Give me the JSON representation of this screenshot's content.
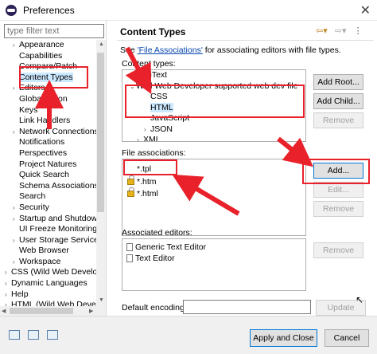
{
  "window": {
    "title": "Preferences",
    "close": "✕"
  },
  "left": {
    "filter_placeholder": "type filter text",
    "tree": [
      {
        "label": "Appearance",
        "indent": 2,
        "arrow": "›"
      },
      {
        "label": "Capabilities",
        "indent": 2,
        "arrow": ""
      },
      {
        "label": "Compare/Patch",
        "indent": 2,
        "arrow": ""
      },
      {
        "label": "Content Types",
        "indent": 2,
        "arrow": "",
        "selected": true
      },
      {
        "label": "Editors",
        "indent": 2,
        "arrow": "›"
      },
      {
        "label": "Globalization",
        "indent": 2,
        "arrow": ""
      },
      {
        "label": "Keys",
        "indent": 2,
        "arrow": ""
      },
      {
        "label": "Link Handlers",
        "indent": 2,
        "arrow": ""
      },
      {
        "label": "Network Connections",
        "indent": 2,
        "arrow": "›"
      },
      {
        "label": "Notifications",
        "indent": 2,
        "arrow": ""
      },
      {
        "label": "Perspectives",
        "indent": 2,
        "arrow": ""
      },
      {
        "label": "Project Natures",
        "indent": 2,
        "arrow": ""
      },
      {
        "label": "Quick Search",
        "indent": 2,
        "arrow": ""
      },
      {
        "label": "Schema Associations",
        "indent": 2,
        "arrow": ""
      },
      {
        "label": "Search",
        "indent": 2,
        "arrow": ""
      },
      {
        "label": "Security",
        "indent": 2,
        "arrow": "›"
      },
      {
        "label": "Startup and Shutdown",
        "indent": 2,
        "arrow": "›"
      },
      {
        "label": "UI Freeze Monitoring",
        "indent": 2,
        "arrow": ""
      },
      {
        "label": "User Storage Service",
        "indent": 2,
        "arrow": "›"
      },
      {
        "label": "Web Browser",
        "indent": 2,
        "arrow": ""
      },
      {
        "label": "Workspace",
        "indent": 2,
        "arrow": "›"
      },
      {
        "label": "CSS (Wild Web Developer)",
        "indent": 1,
        "arrow": "›"
      },
      {
        "label": "Dynamic Languages",
        "indent": 1,
        "arrow": "›"
      },
      {
        "label": "Help",
        "indent": 1,
        "arrow": "›"
      },
      {
        "label": "HTML (Wild Web Developer)",
        "indent": 1,
        "arrow": "›"
      }
    ]
  },
  "right": {
    "title": "Content Types",
    "desc_prefix": "See ",
    "desc_link": "'File Associations'",
    "desc_suffix": " for associating editors with file types.",
    "content_types_label": "Content types:",
    "content_types": [
      {
        "label": "WikiText",
        "indent": 1,
        "arrow": "›"
      },
      {
        "label": "Wild Web Developer supported web dev file",
        "indent": 1,
        "arrow": "⌄"
      },
      {
        "label": "CSS",
        "indent": 3,
        "arrow": ""
      },
      {
        "label": "HTML",
        "indent": 3,
        "arrow": "",
        "selected": true
      },
      {
        "label": "JavaScript",
        "indent": 3,
        "arrow": ""
      },
      {
        "label": "JSON",
        "indent": 3,
        "arrow": "›"
      },
      {
        "label": "XML",
        "indent": 2,
        "arrow": "›"
      }
    ],
    "buttons_top": {
      "add_root": "Add Root...",
      "add_child": "Add Child...",
      "remove": "Remove"
    },
    "file_assoc_label": "File associations:",
    "file_assoc": [
      {
        "label": "*.tpl",
        "locked": false
      },
      {
        "label": "*.htm",
        "locked": true
      },
      {
        "label": "*.html",
        "locked": true
      }
    ],
    "buttons_mid": {
      "add": "Add...",
      "edit": "Edit...",
      "remove": "Remove"
    },
    "assoc_editors_label": "Associated editors:",
    "assoc_editors": [
      "Generic Text Editor",
      "Text Editor"
    ],
    "buttons_low": {
      "remove": "Remove"
    },
    "encoding_label": "Default encoding:",
    "encoding_value": "",
    "update": "Update"
  },
  "bottom": {
    "apply_close": "Apply and Close",
    "cancel": "Cancel"
  }
}
